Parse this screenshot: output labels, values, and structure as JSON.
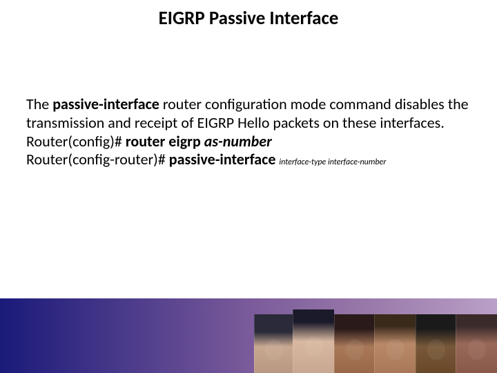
{
  "title": "EIGRP Passive Interface",
  "body": {
    "p1_a": "The ",
    "p1_bold": "passive-interface",
    "p1_b": " router configuration mode command disables the transmission and receipt of EIGRP Hello packets on these interfaces.",
    "p2_a": "Router(config)# ",
    "p2_bold": "router eigrp ",
    "p2_italic": "as-number",
    "p3_a": "Router(config-router)# ",
    "p3_bold": "passive-interface ",
    "p3_small": "interface-type interface-number"
  }
}
